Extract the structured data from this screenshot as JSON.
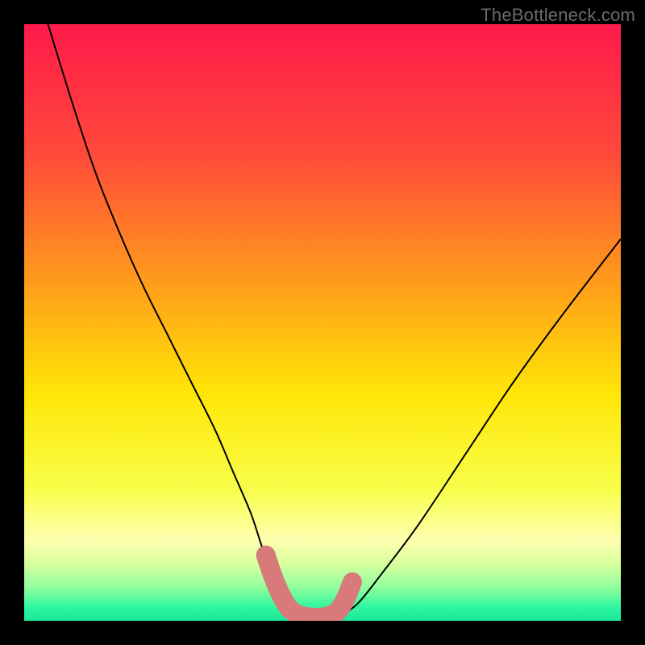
{
  "watermark": "TheBottleneck.com",
  "chart_data": {
    "type": "line",
    "title": "",
    "xlabel": "",
    "ylabel": "",
    "xlim": [
      0,
      100
    ],
    "ylim": [
      0,
      100
    ],
    "gradient_stops": [
      {
        "offset": 0.0,
        "color": "#ff1a4b"
      },
      {
        "offset": 0.22,
        "color": "#ff4a3a"
      },
      {
        "offset": 0.45,
        "color": "#ffa318"
      },
      {
        "offset": 0.62,
        "color": "#ffe607"
      },
      {
        "offset": 0.78,
        "color": "#f8ff4a"
      },
      {
        "offset": 0.865,
        "color": "#ffffb0"
      },
      {
        "offset": 0.905,
        "color": "#d6ff9e"
      },
      {
        "offset": 0.945,
        "color": "#8fff9e"
      },
      {
        "offset": 0.975,
        "color": "#34f7a0"
      },
      {
        "offset": 1.0,
        "color": "#18e89a"
      }
    ],
    "series": [
      {
        "name": "curve",
        "x": [
          4,
          8,
          12,
          16,
          20,
          24,
          28,
          32,
          35,
          38,
          40,
          42,
          44,
          46,
          48,
          50,
          53,
          56,
          60,
          66,
          74,
          82,
          90,
          100
        ],
        "y": [
          100,
          87,
          75,
          65,
          56,
          48,
          40,
          32,
          25,
          18,
          12,
          7,
          3,
          1,
          0.3,
          0.3,
          1,
          3,
          8,
          16,
          28,
          40,
          51,
          64
        ]
      }
    ],
    "highlight": {
      "name": "bottleneck-marker",
      "color": "#d97a7a",
      "x": [
        40.5,
        41.5,
        42.5,
        43.5,
        44.5,
        46,
        48,
        50,
        52,
        53,
        54,
        55
      ],
      "y": [
        11,
        8,
        5.5,
        3.5,
        2,
        1,
        0.6,
        0.6,
        1.2,
        2.2,
        4,
        6.5
      ]
    }
  }
}
